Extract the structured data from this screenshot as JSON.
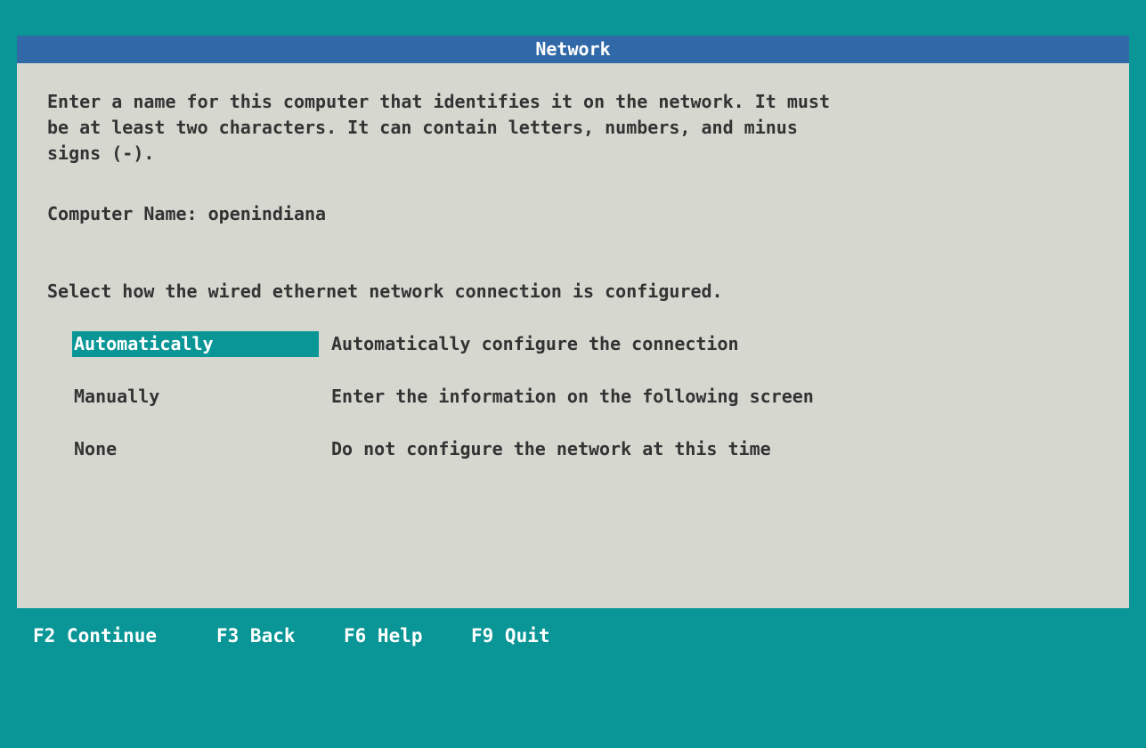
{
  "dialog": {
    "title": "Network",
    "intro_lines": [
      "Enter a name for this computer that identifies it on the network. It must",
      "be at least two characters. It can contain letters, numbers, and minus",
      "signs (-)."
    ],
    "computer_name_label": "Computer Name:",
    "computer_name_value": "openindiana",
    "select_prompt": "Select how the wired ethernet network connection is configured.",
    "options": [
      {
        "label": "Automatically",
        "description": "Automatically configure the connection",
        "selected": true
      },
      {
        "label": "Manually",
        "description": "Enter the information on the following screen",
        "selected": false
      },
      {
        "label": "None",
        "description": "Do not configure the network at this time",
        "selected": false
      }
    ]
  },
  "footer": {
    "keys": [
      "F2 Continue",
      "F3 Back",
      "F6 Help",
      "F9 Quit"
    ]
  },
  "colors": {
    "background": "#0a9696",
    "title_bar": "#3068a8",
    "dialog": "#d6d8d0",
    "selection": "#0a9696",
    "text": "#333333"
  }
}
